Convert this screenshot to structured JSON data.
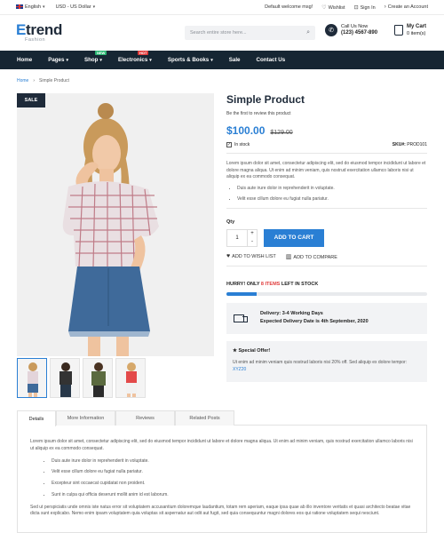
{
  "topbar": {
    "language": "English",
    "currency": "USD - US Dollar",
    "welcome": "Default welcome msg!",
    "wishlist": "Wishlist",
    "signin": "Sign In",
    "create_account": "Create an Account"
  },
  "header": {
    "logo_main": "Etrend",
    "logo_sub": "Fashion",
    "search_placeholder": "Search entire store here...",
    "call_label": "Call Us Now",
    "call_number": "(123) 4567-890",
    "cart_label": "My Cart",
    "cart_count": "0 item(s)"
  },
  "nav": {
    "items": [
      {
        "label": "Home"
      },
      {
        "label": "Pages"
      },
      {
        "label": "Shop",
        "badge": "NEW",
        "badge_color": "#2bb673"
      },
      {
        "label": "Electronics",
        "badge": "HOT",
        "badge_color": "#e03b3b"
      },
      {
        "label": "Sports & Books"
      },
      {
        "label": "Sale"
      },
      {
        "label": "Contact Us"
      }
    ]
  },
  "breadcrumb": {
    "home": "Home",
    "current": "Simple Product"
  },
  "product": {
    "sale_badge": "SALE",
    "title": "Simple Product",
    "review_text": "Be the first to review this product",
    "price": "$100.00",
    "old_price": "$129.00",
    "stock": "In stock",
    "sku_label": "SKU#:",
    "sku_value": "PROD101",
    "description": "Lorem ipsum dolor sit amet, consectetur adipiscing elit, sed do eiusmod tempor incididunt ut labore et dolore magna aliqua. Ut enim ad minim veniam, quis nostrud exercitation ullamco laboris nisi ut aliquip ex ea commodo consequat.",
    "bullets": [
      "Duis aute irure dolor in reprehenderit in voluptate.",
      "Velit esse cillum dolore eu fugiat nulla pariatur."
    ],
    "qty_label": "Qty",
    "qty_value": "1",
    "add_to_cart": "ADD TO CART",
    "wishlist": "ADD TO WISH LIST",
    "compare": "ADD TO COMPARE",
    "hurry_prefix": "HURRY! ONLY",
    "hurry_count": "8 ITEMS",
    "hurry_suffix": "LEFT IN STOCK",
    "stock_progress": 0.15,
    "delivery_line1": "Delivery: 3-4 Working Days",
    "delivery_line2": "Expected Delivery Date is 4th September, 2020",
    "offer_title": "Special Offer!",
    "offer_text": "Ut enim ad minim veniam quis nostrud laboris nisi 20% off. Sed aliquip ex dolore tempor:",
    "offer_code": "XYZ20"
  },
  "tabs": {
    "items": [
      "Details",
      "More Information",
      "Reviews",
      "Related Posts"
    ],
    "active": "Details",
    "intro": "Lorem ipsum dolor sit amet, consectetur adipiscing elit, sed do eiusmod tempor incididunt ut labore et dolore magna aliqua. Ut enim ad minim veniam, quis nostrud exercitation ullamco laboris nisi ut aliquip ex ea commodo consequat.",
    "bullets": [
      "Duis aute irure dolor in reprehenderit in voluptate.",
      "Velit esse cillum dolore eu fugiat nulla pariatur.",
      "Excepteur sint occaecat cupidatat non proident.",
      "Sunt in culpa qui officia deserunt mollit anim id est laborum."
    ],
    "outro": "Sed ut perspiciatis unde omnis iste natus error sit voluptatem accusantium doloremque laudantium, totam rem aperiam, eaque ipsa quae ab illo inventore veritatis et quasi architecto beatae vitae dicta sunt explicabo. Nemo enim ipsam voluptatem quia voluptas sit aspernatur aut odit aut fugit, sed quia consequuntur magni dolores eos qui ratione voluptatem sequi nesciunt."
  },
  "colors": {
    "accent": "#2a7fd4",
    "nav_bg": "#162633",
    "hot": "#e03b3b"
  }
}
